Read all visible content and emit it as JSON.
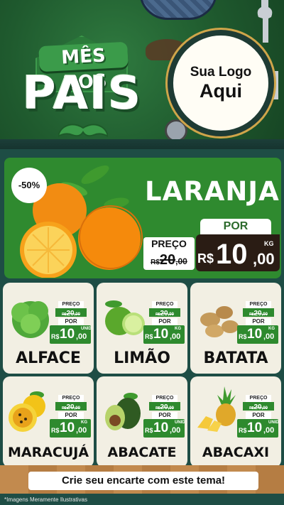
{
  "header": {
    "title_small": "MÊS DOS",
    "title_big": "PAIS",
    "logo_line1": "Sua Logo",
    "logo_line2": "Aqui"
  },
  "featured": {
    "discount": "-50%",
    "name": "LARANJA",
    "por_label": "POR",
    "preco_label": "PREÇO",
    "old_price": {
      "currency": "R$",
      "int": "20",
      "dec": ",00"
    },
    "new_price": {
      "currency": "R$",
      "int": "10",
      "dec": ",00",
      "unit": "KG"
    }
  },
  "products": [
    {
      "name": "ALFACE",
      "old_label": "PREÇO",
      "por_label": "POR",
      "old_price": {
        "currency": "R$",
        "int": "20",
        "dec": ",00"
      },
      "new_price": {
        "currency": "R$",
        "int": "10",
        "dec": ",00",
        "unit": "UNID"
      }
    },
    {
      "name": "LIMÃO",
      "old_label": "PREÇO",
      "por_label": "POR",
      "old_price": {
        "currency": "R$",
        "int": "20",
        "dec": ",00"
      },
      "new_price": {
        "currency": "R$",
        "int": "10",
        "dec": ",00",
        "unit": "KG"
      }
    },
    {
      "name": "BATATA",
      "old_label": "PREÇO",
      "por_label": "POR",
      "old_price": {
        "currency": "R$",
        "int": "20",
        "dec": ",00"
      },
      "new_price": {
        "currency": "R$",
        "int": "10",
        "dec": ",00",
        "unit": "KG"
      }
    },
    {
      "name": "MARACUJÁ",
      "old_label": "PREÇO",
      "por_label": "POR",
      "old_price": {
        "currency": "R$",
        "int": "20",
        "dec": ",00"
      },
      "new_price": {
        "currency": "R$",
        "int": "10",
        "dec": ",00",
        "unit": "KG"
      }
    },
    {
      "name": "ABACATE",
      "old_label": "PREÇO",
      "por_label": "POR",
      "old_price": {
        "currency": "R$",
        "int": "20",
        "dec": ",00"
      },
      "new_price": {
        "currency": "R$",
        "int": "10",
        "dec": ",00",
        "unit": "UNID"
      }
    },
    {
      "name": "ABACAXI",
      "old_label": "PREÇO",
      "por_label": "POR",
      "old_price": {
        "currency": "R$",
        "int": "20",
        "dec": ",00"
      },
      "new_price": {
        "currency": "R$",
        "int": "10",
        "dec": ",00",
        "unit": "UNID"
      }
    }
  ],
  "footer": {
    "cta": "Crie seu encarte com este tema!",
    "disclaimer": "*Imagens Meramente Ilustrativas"
  },
  "colors": {
    "background": "#1e4d45",
    "accent_green": "#2e8a2e",
    "card": "#f2efe3",
    "price_dark": "#2a1c14"
  }
}
